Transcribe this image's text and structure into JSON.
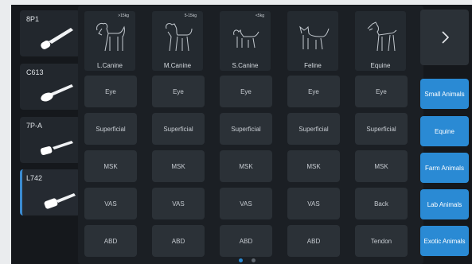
{
  "probes": [
    {
      "name": "8P1",
      "active": false
    },
    {
      "name": "C613",
      "active": false
    },
    {
      "name": "7P-A",
      "active": false
    },
    {
      "name": "L742",
      "active": true
    }
  ],
  "animals": [
    {
      "name": "L.Canine",
      "weight": ">15kg",
      "icon": "large-dog-icon"
    },
    {
      "name": "M.Canine",
      "weight": "5-15kg",
      "icon": "medium-dog-icon"
    },
    {
      "name": "S.Canine",
      "weight": "<5kg",
      "icon": "small-dog-icon"
    },
    {
      "name": "Feline",
      "weight": "",
      "icon": "cat-icon"
    },
    {
      "name": "Equine",
      "weight": "",
      "icon": "horse-icon"
    }
  ],
  "presets": [
    [
      "Eye",
      "Eye",
      "Eye",
      "Eye",
      "Eye"
    ],
    [
      "Superficial",
      "Superficial",
      "Superficial",
      "Superficial",
      "Superficial"
    ],
    [
      "MSK",
      "MSK",
      "MSK",
      "MSK",
      "MSK"
    ],
    [
      "VAS",
      "VAS",
      "VAS",
      "VAS",
      "Back"
    ],
    [
      "ABD",
      "ABD",
      "ABD",
      "ABD",
      "Tendon"
    ]
  ],
  "pager": {
    "pages": 2,
    "current": 1
  },
  "next_button": {
    "icon": "chevron-right-icon"
  },
  "categories": [
    "Small Animals",
    "Equine",
    "Farm Animals",
    "Lab Animals",
    "Exotic Animals"
  ],
  "colors": {
    "accent": "#2a8ad4",
    "active_border": "#3b8bd0",
    "background": "#15181c"
  }
}
